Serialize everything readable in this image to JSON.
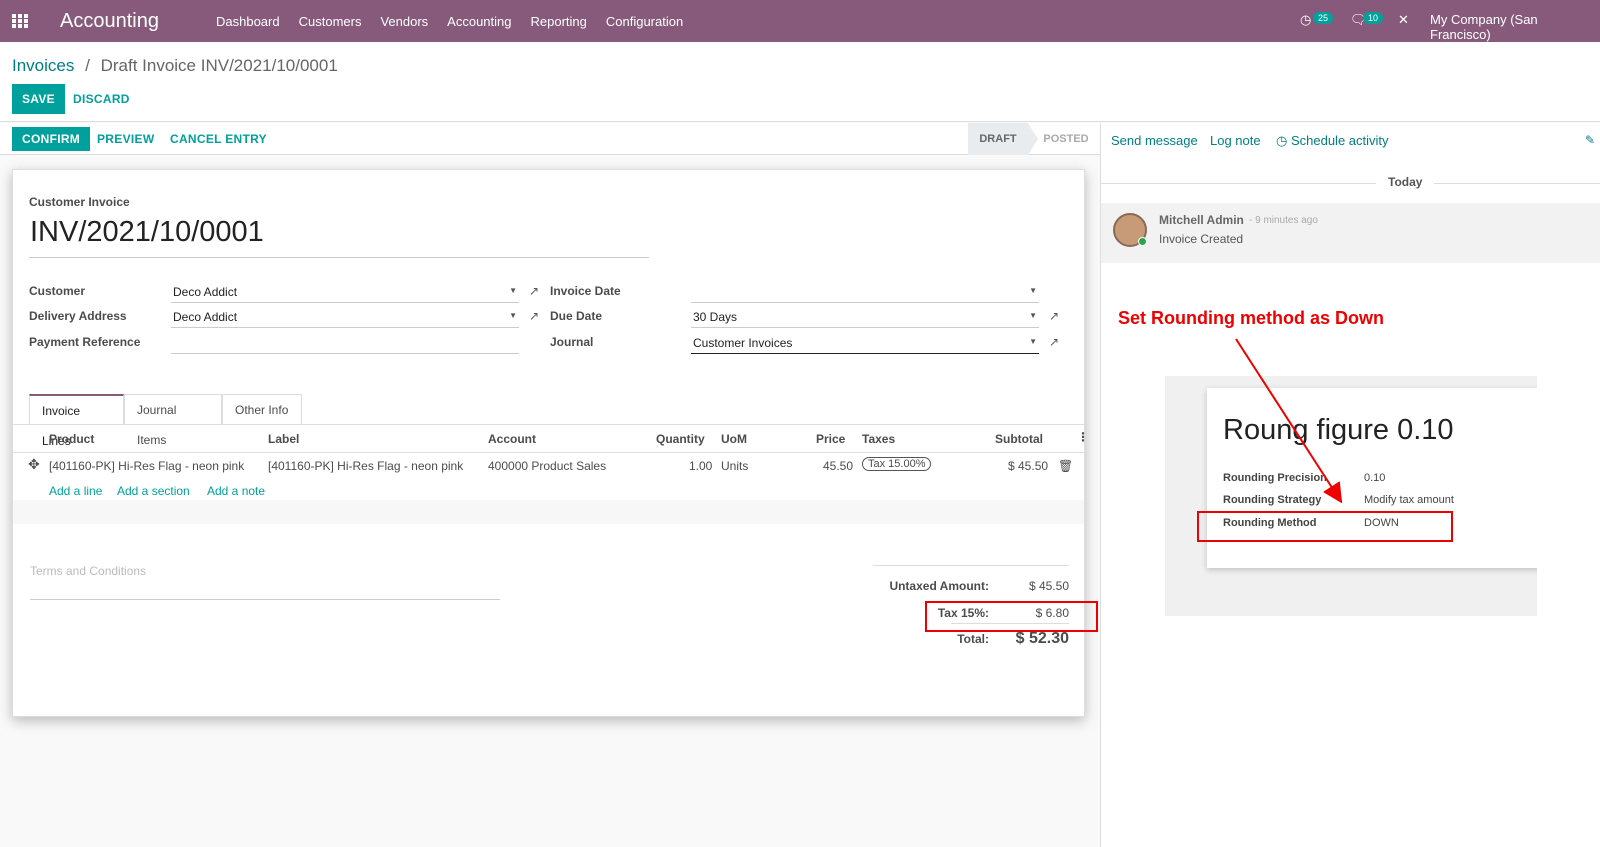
{
  "topbar": {
    "app_name": "Accounting",
    "menu": [
      "Dashboard",
      "Customers",
      "Vendors",
      "Accounting",
      "Reporting",
      "Configuration"
    ],
    "activity_count": "25",
    "message_count": "10",
    "company": "My Company (San Francisco)"
  },
  "breadcrumb": {
    "parent": "Invoices",
    "separator": "/",
    "current": "Draft Invoice INV/2021/10/0001"
  },
  "actions": {
    "save": "SAVE",
    "discard": "DISCARD",
    "confirm": "CONFIRM",
    "preview": "PREVIEW",
    "cancel_entry": "CANCEL ENTRY"
  },
  "status": {
    "draft": "DRAFT",
    "posted": "POSTED"
  },
  "invoice": {
    "type_label": "Customer Invoice",
    "number": "INV/2021/10/0001",
    "customer_label": "Customer",
    "customer": "Deco Addict",
    "delivery_label": "Delivery Address",
    "delivery": "Deco Addict",
    "payment_ref_label": "Payment Reference",
    "payment_ref": "",
    "invoice_date_label": "Invoice Date",
    "invoice_date": "",
    "due_date_label": "Due Date",
    "due_date": "30 Days",
    "journal_label": "Journal",
    "journal": "Customer Invoices"
  },
  "tabs": [
    "Invoice Lines",
    "Journal Items",
    "Other Info"
  ],
  "lines": {
    "headers": [
      "Product",
      "Label",
      "Account",
      "Quantity",
      "UoM",
      "Price",
      "Taxes",
      "Subtotal"
    ],
    "rows": [
      {
        "product": "[401160-PK] Hi-Res Flag - neon pink",
        "label": "[401160-PK] Hi-Res Flag - neon pink",
        "account": "400000 Product Sales",
        "quantity": "1.00",
        "uom": "Units",
        "price": "45.50",
        "taxes": "Tax 15.00%",
        "subtotal": "$ 45.50"
      }
    ],
    "add_line": "Add a line",
    "add_section": "Add a section",
    "add_note": "Add a note"
  },
  "terms_placeholder": "Terms and Conditions",
  "totals": {
    "untaxed_label": "Untaxed Amount:",
    "untaxed": "$ 45.50",
    "tax_label": "Tax 15%:",
    "tax": "$ 6.80",
    "total_label": "Total:",
    "total": "$ 52.30"
  },
  "chatter": {
    "send_message": "Send message",
    "log_note": "Log note",
    "schedule_activity": "Schedule activity",
    "day": "Today",
    "author": "Mitchell Admin",
    "time": "- 9 minutes ago",
    "body": "Invoice Created"
  },
  "annotation": {
    "note": "Set Rounding method as Down",
    "inset_title": "Roung figure 0.10",
    "precision_label": "Rounding Precision",
    "precision": "0.10",
    "strategy_label": "Rounding Strategy",
    "strategy": "Modify tax amount",
    "method_label": "Rounding Method",
    "method": "DOWN"
  },
  "colors": {
    "topbar": "#875a7b",
    "accent": "#00a09d",
    "link": "#017e84",
    "annotation_red": "#ee0000"
  }
}
